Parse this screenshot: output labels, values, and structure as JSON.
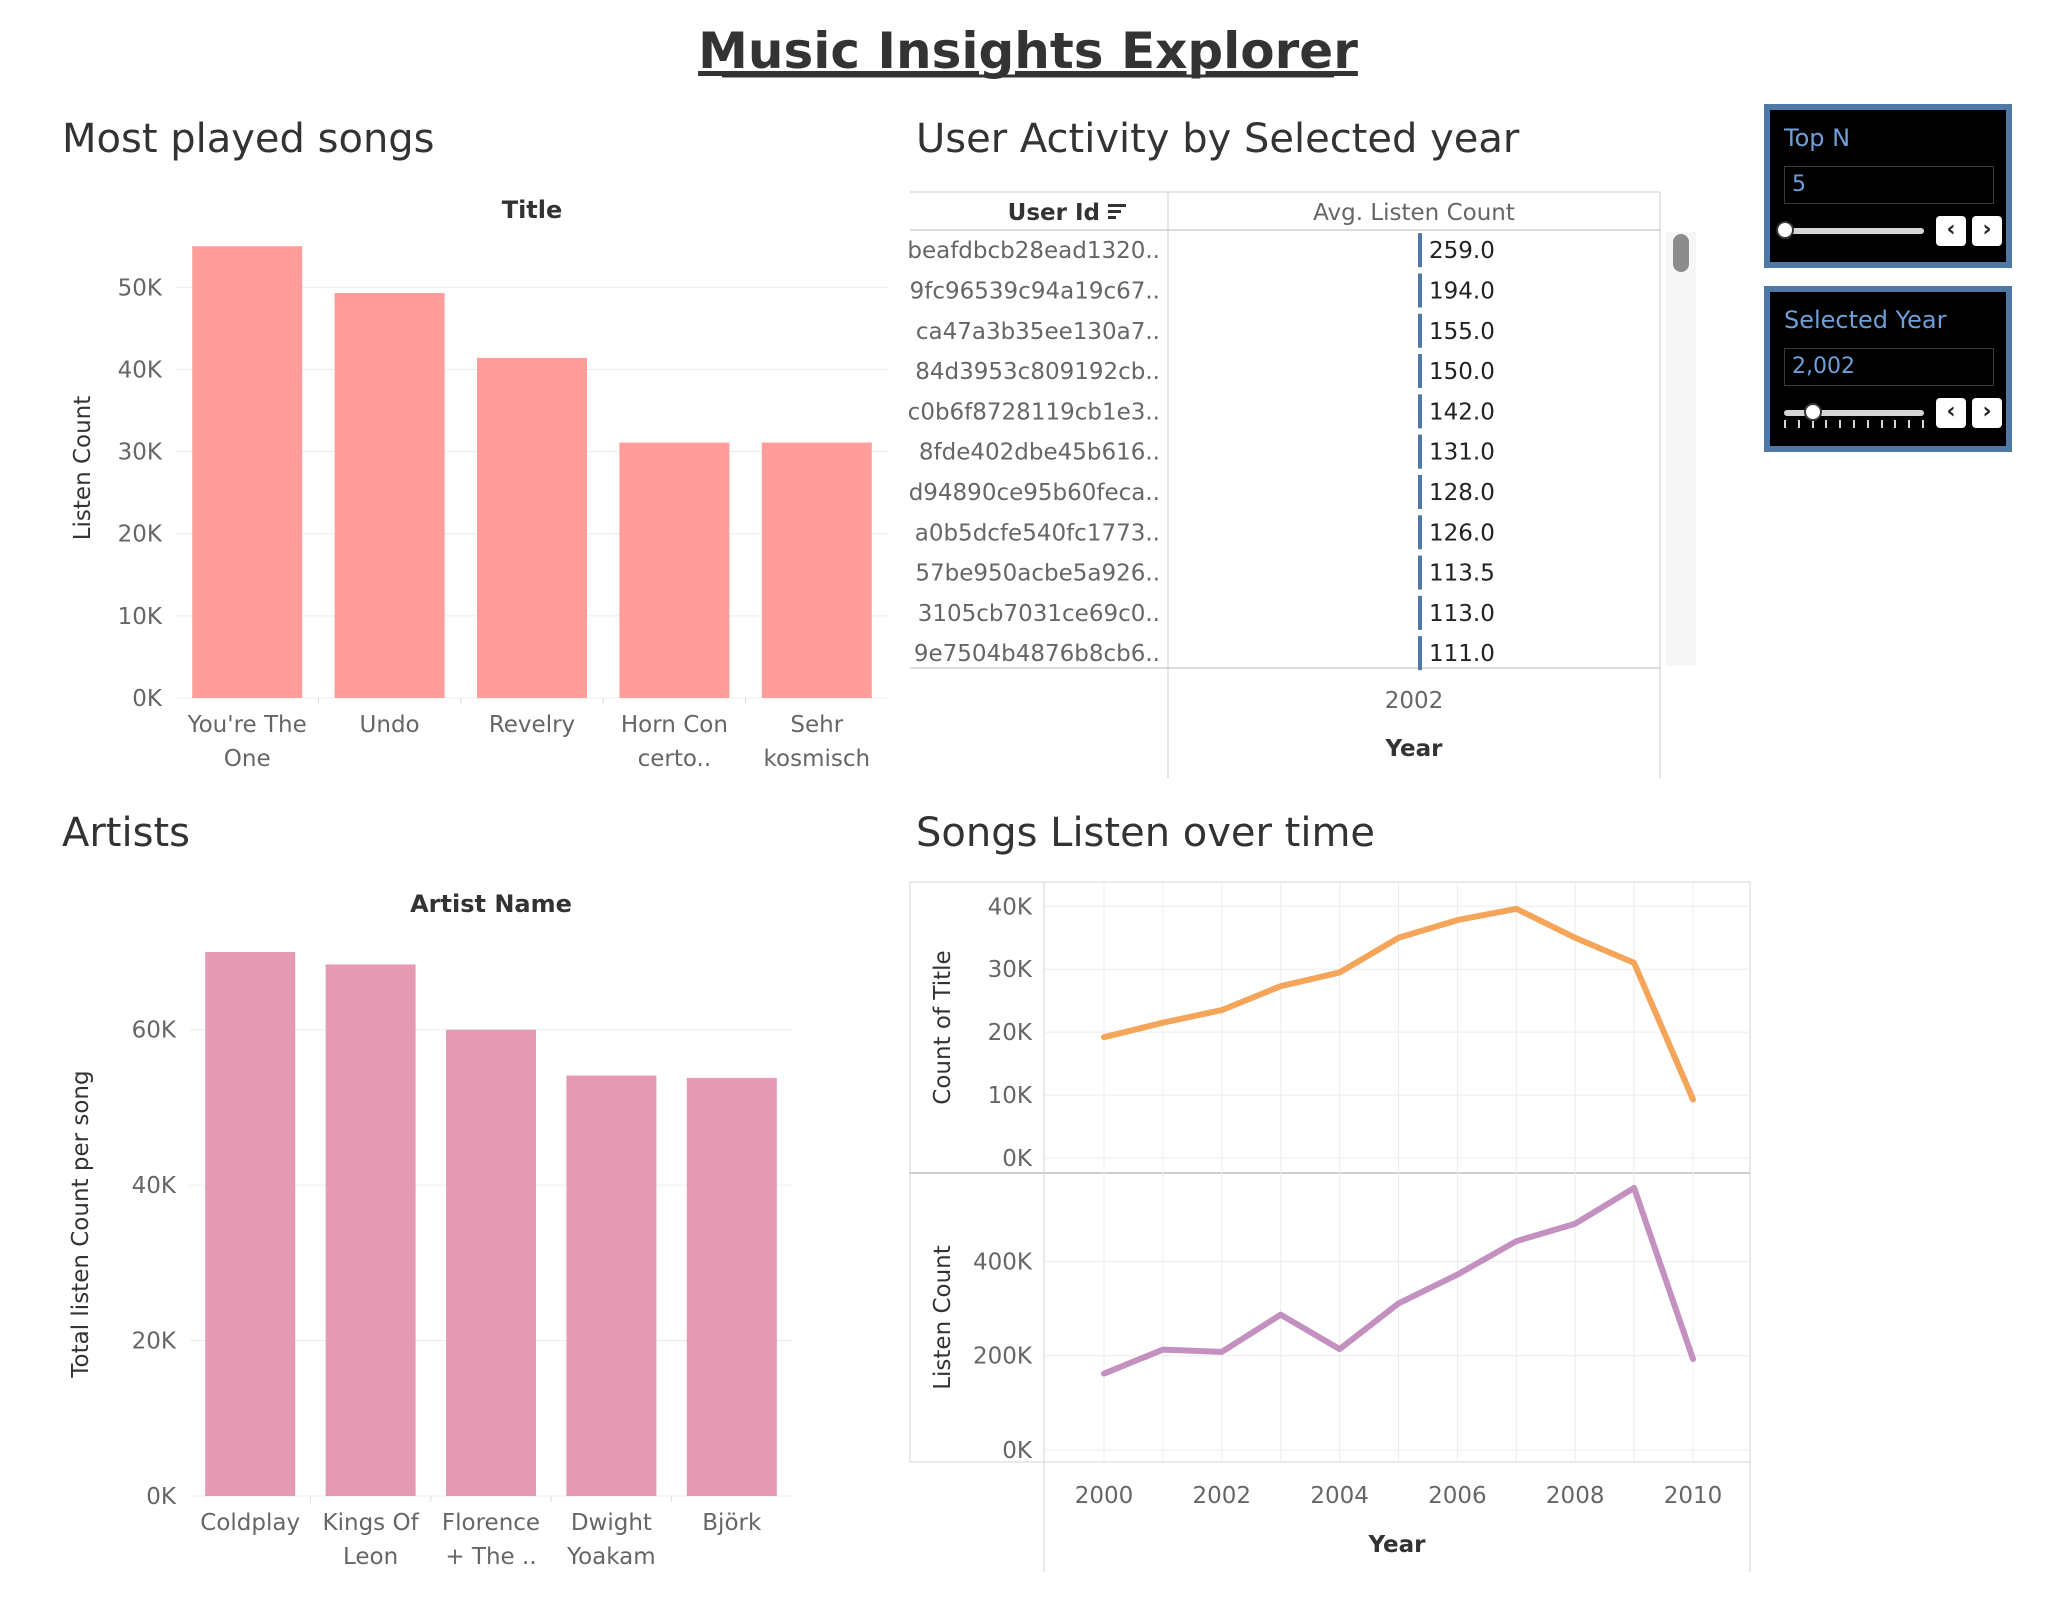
{
  "dashboard_title": "Music Insights Explorer",
  "panels": {
    "songs_title": "Most played songs",
    "activity_title": "User Activity by Selected year",
    "artists_title": "Artists",
    "overtime_title": "Songs Listen over time"
  },
  "controls": {
    "top_n": {
      "label": "Top N",
      "value": "5",
      "level": 0.0
    },
    "selected_year": {
      "label": "Selected Year",
      "value": "2,002",
      "level": 0.2
    },
    "prev_glyph": "‹",
    "next_glyph": "›"
  },
  "colors": {
    "songs_bar": "#ff9d9a",
    "artists_bar": "#e699b3",
    "line_count": "#f5a55a",
    "line_listen": "#c390c0",
    "activity_bar": "#4e79a7",
    "text": "#333333",
    "axis_text": "#666666",
    "grid": "#ececec"
  },
  "chart_data": [
    {
      "id": "songs",
      "type": "bar",
      "column_header": "Title",
      "ylabel": "Listen Count",
      "categories": [
        "You're The One",
        "Undo",
        "Revelry",
        "Horn Concerto..",
        "Sehr kosmisch"
      ],
      "category_labels": [
        [
          "You're The",
          "One"
        ],
        [
          "Undo"
        ],
        [
          "Revelry"
        ],
        [
          "Horn Con",
          "certo.."
        ],
        [
          "Sehr",
          "kosmisch"
        ]
      ],
      "values": [
        55000,
        49300,
        41400,
        31100,
        31100
      ],
      "ylim": [
        0,
        56000
      ],
      "yticks": [
        0,
        10000,
        20000,
        30000,
        40000,
        50000
      ],
      "ytick_labels": [
        "0K",
        "10K",
        "20K",
        "30K",
        "40K",
        "50K"
      ],
      "grid": true
    },
    {
      "id": "activity",
      "type": "table",
      "row_header": "User Id",
      "column_header": "Avg. Listen Count",
      "column_value": "2002",
      "column_axis": "Year",
      "rows": [
        {
          "user": "beafdbcb28ead1320..",
          "value": "259.0"
        },
        {
          "user": "9fc96539c94a19c67..",
          "value": "194.0"
        },
        {
          "user": "ca47a3b35ee130a7..",
          "value": "155.0"
        },
        {
          "user": "84d3953c809192cb..",
          "value": "150.0"
        },
        {
          "user": "c0b6f8728119cb1e3..",
          "value": "142.0"
        },
        {
          "user": "8fde402dbe45b616..",
          "value": "131.0"
        },
        {
          "user": "d94890ce95b60feca..",
          "value": "128.0"
        },
        {
          "user": "a0b5dcfe540fc1773..",
          "value": "126.0"
        },
        {
          "user": "57be950acbe5a926..",
          "value": "113.5"
        },
        {
          "user": "3105cb7031ce69c0..",
          "value": "113.0"
        },
        {
          "user": "9e7504b4876b8cb6..",
          "value": "111.0"
        }
      ]
    },
    {
      "id": "artists",
      "type": "bar",
      "column_header": "Artist Name",
      "ylabel": "Total listen Count per song",
      "categories": [
        "Coldplay",
        "Kings Of Leon",
        "Florence + The ..",
        "Dwight Yoakam",
        "Björk"
      ],
      "category_labels": [
        [
          "Coldplay"
        ],
        [
          "Kings Of",
          "Leon"
        ],
        [
          "Florence",
          "+ The .."
        ],
        [
          "Dwight",
          "Yoakam"
        ],
        [
          "Björk"
        ]
      ],
      "values": [
        70000,
        68400,
        60000,
        54100,
        53800
      ],
      "ylim": [
        0,
        70000
      ],
      "yticks": [
        0,
        20000,
        40000,
        60000
      ],
      "ytick_labels": [
        "0K",
        "20K",
        "40K",
        "60K"
      ],
      "grid": true
    },
    {
      "id": "overtime",
      "type": "line",
      "x": [
        2000,
        2001,
        2002,
        2003,
        2004,
        2005,
        2006,
        2007,
        2008,
        2009,
        2010
      ],
      "xlabel": "Year",
      "xticks": [
        2000,
        2002,
        2004,
        2006,
        2008,
        2010
      ],
      "xtick_labels": [
        "2000",
        "2002",
        "2004",
        "2006",
        "2008",
        "2010"
      ],
      "grid": true,
      "panes": [
        {
          "ylabel": "Count of Title",
          "values": [
            19200,
            21500,
            23500,
            27300,
            29500,
            35000,
            37800,
            39600,
            35000,
            31000,
            9300
          ],
          "ylim": [
            0,
            41000
          ],
          "yticks": [
            0,
            10000,
            20000,
            30000,
            40000
          ],
          "ytick_labels": [
            "0K",
            "10K",
            "20K",
            "30K",
            "40K"
          ]
        },
        {
          "ylabel": "Listen Count",
          "values": [
            162000,
            213000,
            208000,
            287000,
            214000,
            311000,
            372000,
            443000,
            480000,
            556000,
            193000
          ],
          "ylim": [
            0,
            560000
          ],
          "yticks": [
            0,
            200000,
            400000
          ],
          "ytick_labels": [
            "0K",
            "200K",
            "400K"
          ]
        }
      ]
    }
  ]
}
